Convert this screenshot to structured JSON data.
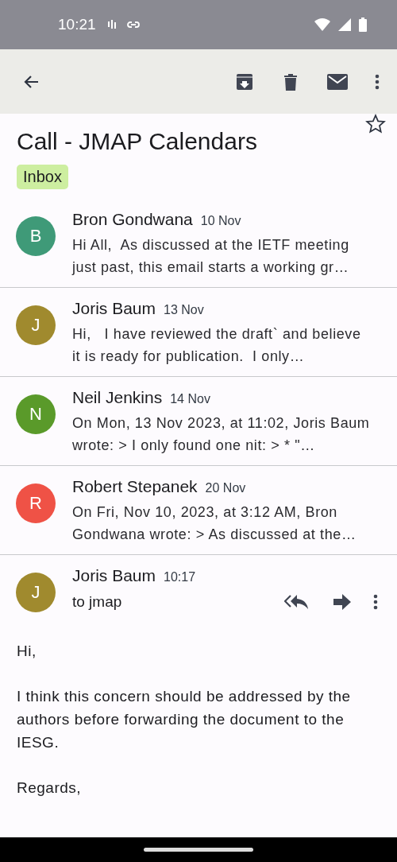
{
  "status_bar": {
    "time": "10:21"
  },
  "title_lines": [
    "Call - JMAP Calendars"
  ],
  "starred": false,
  "labels": [
    {
      "text": "Inbox",
      "color": "#cdeea0"
    }
  ],
  "messages": [
    {
      "initial": "B",
      "color": "#3f9a78",
      "sender": "Bron Gondwana",
      "date": "10 Nov",
      "preview": "Hi All,  As discussed at the IETF meeting just past, this email starts a working gr…"
    },
    {
      "initial": "J",
      "color": "#a08a2e",
      "sender": "Joris Baum",
      "date": "13 Nov",
      "preview": "Hi,   I have reviewed the draft` and believe it is ready for publication.  I only…"
    },
    {
      "initial": "N",
      "color": "#5a9a2a",
      "sender": "Neil Jenkins",
      "date": "14 Nov",
      "preview": "On Mon, 13 Nov 2023, at 11:02, Joris Baum wrote: > I only found one nit: > * \"…"
    },
    {
      "initial": "R",
      "color": "#ef5246",
      "sender": "Robert Stepanek",
      "date": "20 Nov",
      "preview": "On Fri, Nov 10, 2023, at 3:12 AM, Bron Gondwana wrote: > As discussed at the…"
    }
  ],
  "open_message": {
    "initial": "J",
    "color": "#a08a2e",
    "sender": "Joris Baum",
    "time": "10:17",
    "recipients": "to jmap",
    "body": [
      "Hi,",
      "I think this concern should be addressed by the authors before forwarding the document to the IESG.",
      "Regards,"
    ]
  }
}
